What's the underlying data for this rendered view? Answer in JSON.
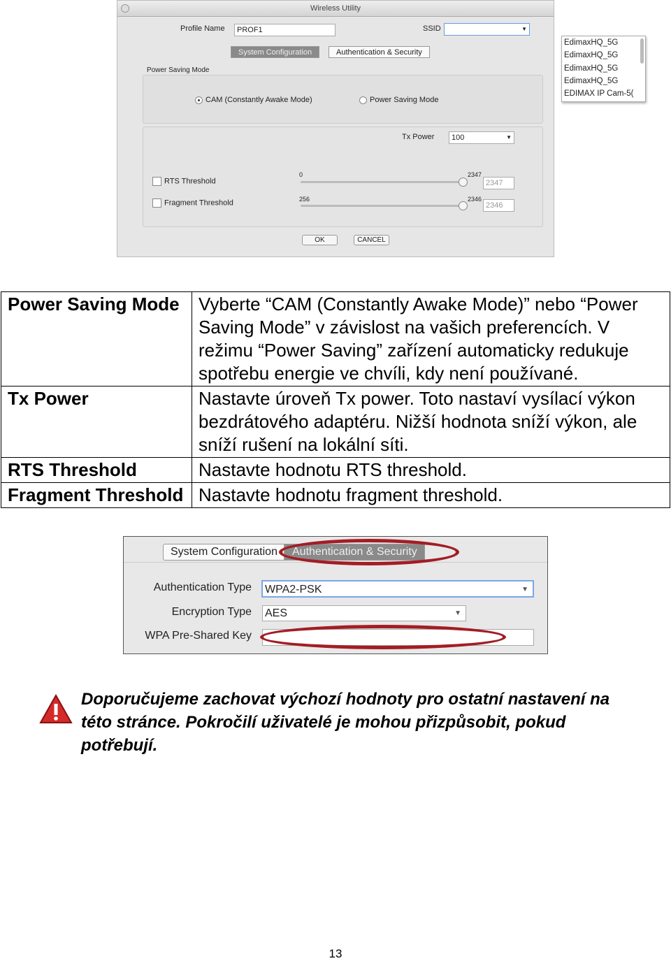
{
  "screenshot1": {
    "title": "Wireless Utility",
    "profile_name_label": "Profile Name",
    "profile_name_value": "PROF1",
    "ssid_label": "SSID",
    "ssid_value": "",
    "ssid_options": [
      "EdimaxHQ_5G",
      "EdimaxHQ_5G",
      "EdimaxHQ_5G",
      "EdimaxHQ_5G",
      "EDIMAX IP Cam-5("
    ],
    "tabs": [
      "System Configuration",
      "Authentication & Security"
    ],
    "active_tab": "System Configuration",
    "power_saving_label": "Power Saving Mode",
    "radio_cam": "CAM (Constantly Awake Mode)",
    "radio_psm": "Power Saving Mode",
    "selected_mode": "CAM",
    "tx_power_label": "Tx Power",
    "tx_power_value": "100",
    "rts_label": "RTS Threshold",
    "rts_min": "0",
    "rts_max": "2347",
    "rts_value": "2347",
    "rts_checked": false,
    "frag_label": "Fragment Threshold",
    "frag_min": "256",
    "frag_max": "2346",
    "frag_value": "2346",
    "frag_checked": false,
    "ok": "OK",
    "cancel": "CANCEL"
  },
  "table": [
    {
      "key": "Power Saving Mode",
      "lines": [
        "Vyberte “CAM (Constantly Awake Mode)” nebo “Power",
        "Saving Mode” v závislost na vašich preferencích. V",
        "režimu “Power Saving” zařízení automaticky redukuje",
        "spotřebu energie ve chvíli, kdy není používané."
      ]
    },
    {
      "key": "Tx Power",
      "lines": [
        "Nastavte úroveň Tx power. Toto nastaví vysílací výkon",
        "bezdrátového adaptéru. Nižší hodnota sníží výkon, ale",
        "sníží rušení na lokální síti."
      ]
    },
    {
      "key": "RTS Threshold",
      "lines": [
        "Nastavte hodnotu RTS threshold."
      ]
    },
    {
      "key": "Fragment Threshold",
      "lines": [
        "Nastavte hodnotu fragment threshold."
      ]
    }
  ],
  "screenshot2": {
    "tabs": [
      "System Configuration",
      "Authentication & Security"
    ],
    "active_tab": "Authentication & Security",
    "auth_label": "Authentication Type",
    "auth_value": "WPA2-PSK",
    "enc_label": "Encryption Type",
    "enc_value": "AES",
    "psk_label": "WPA Pre-Shared Key",
    "psk_value": "",
    "highlight_color": "#a31d24"
  },
  "warning": {
    "icon": "warning-triangle-icon",
    "lines": [
      "Doporučujeme zachovat výchozí hodnoty pro ostatní nastavení na",
      "této stránce. Pokročilí uživatelé je mohou přizpůsobit, pokud",
      "potřebují."
    ]
  },
  "page_number": "13"
}
